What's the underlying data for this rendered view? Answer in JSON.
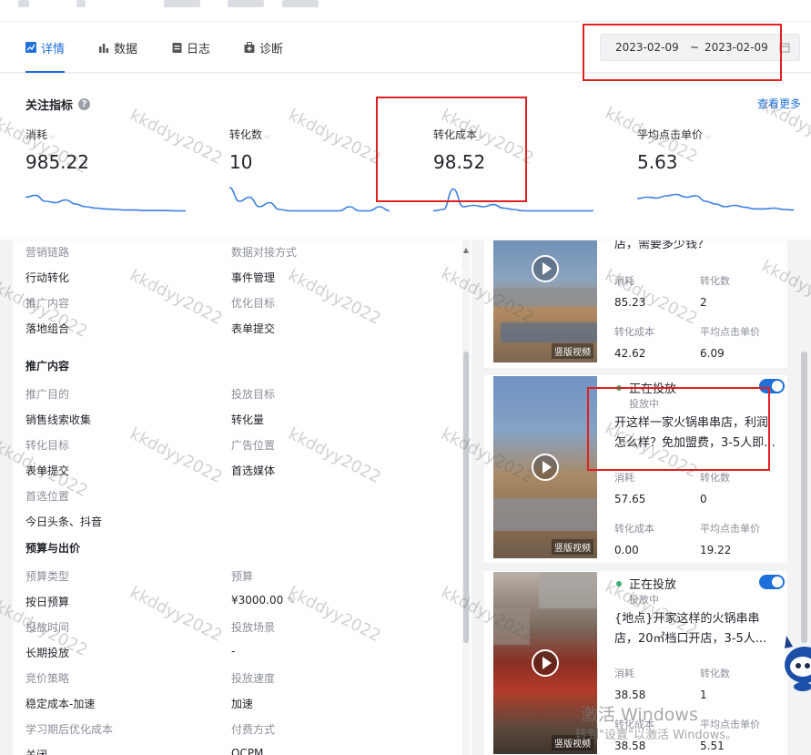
{
  "tabs": [
    {
      "label": "详情",
      "icon": "chart-icon"
    },
    {
      "label": "数据",
      "icon": "bar-chart-icon"
    },
    {
      "label": "日志",
      "icon": "log-icon"
    },
    {
      "label": "诊断",
      "icon": "diagnose-icon"
    }
  ],
  "date_range": {
    "start": "2023-02-09",
    "separator": "~",
    "end": "2023-02-09"
  },
  "metrics": {
    "title": "关注指标",
    "more": "查看更多",
    "items": [
      {
        "label": "消耗",
        "value": "985.22",
        "spark": [
          0.55,
          0.62,
          0.4,
          0.35,
          0.45,
          0.3,
          0.2,
          0.15,
          0.12,
          0.1,
          0.08,
          0.08,
          0.06,
          0.06,
          0.06,
          0.05,
          0.05
        ]
      },
      {
        "label": "转化数",
        "value": "10",
        "spark": [
          0.9,
          0.4,
          0.55,
          0.2,
          0.35,
          0.1,
          0.05,
          0.05,
          0.05,
          0.05,
          0.05,
          0.05,
          0.2,
          0.05,
          0.05,
          0.2,
          0.05
        ]
      },
      {
        "label": "转化成本",
        "value": "98.52",
        "spark": [
          0.05,
          0.1,
          0.85,
          0.2,
          0.25,
          0.2,
          0.28,
          0.15,
          0.1,
          0.05,
          0.05,
          0.05,
          0.05,
          0.05,
          0.05,
          0.05,
          0.05
        ]
      },
      {
        "label": "平均点击单价",
        "value": "5.63",
        "spark": [
          0.5,
          0.55,
          0.52,
          0.6,
          0.65,
          0.55,
          0.6,
          0.4,
          0.3,
          0.2,
          0.25,
          0.18,
          0.12,
          0.12,
          0.15,
          0.1,
          0.08
        ]
      }
    ]
  },
  "left": {
    "rows": [
      {
        "l1": "营销链路",
        "v1": "行动转化",
        "l2": "数据对接方式",
        "v2": "事件管理"
      },
      {
        "l1": "推广内容",
        "v1": "落地组合",
        "l2": "优化目标",
        "v2": "表单提交"
      }
    ],
    "section1": "推广内容",
    "rows2": [
      {
        "l1": "推广目的",
        "v1": "销售线索收集",
        "l2": "投放目标",
        "v2": "转化量"
      },
      {
        "l1": "转化目标",
        "v1": "表单提交",
        "l2": "广告位置",
        "v2": "首选媒体"
      },
      {
        "l1": "首选位置",
        "v1": "今日头条、抖音",
        "l2": "",
        "v2": ""
      }
    ],
    "section2": "预算与出价",
    "rows3": [
      {
        "l1": "预算类型",
        "v1": "按日预算",
        "l2": "预算",
        "v2": "¥3000.00"
      },
      {
        "l1": "投放时间",
        "v1": "长期投放",
        "l2": "投放场景",
        "v2": "-"
      },
      {
        "l1": "竞价策略",
        "v1": "稳定成本-加速",
        "l2": "投放速度",
        "v2": "加速"
      },
      {
        "l1": "学习期后优化成本",
        "v1": "关闭",
        "l2": "付费方式",
        "v2": "OCPM"
      }
    ]
  },
  "cards": [
    {
      "title": "店，需要多少钱？",
      "video_label": "竖版视频",
      "stats": [
        {
          "label": "消耗",
          "value": "85.23"
        },
        {
          "label": "转化数",
          "value": "2"
        },
        {
          "label": "转化成本",
          "value": "42.62"
        },
        {
          "label": "平均点击单价",
          "value": "6.09"
        }
      ]
    },
    {
      "status": "正在投放",
      "sub": "投放中",
      "title_l1": "开这样一家火锅串串店，利润",
      "title_l2": "怎么样？免加盟费，3-5人即...",
      "video_label": "竖版视频",
      "stats": [
        {
          "label": "消耗",
          "value": "57.65"
        },
        {
          "label": "转化数",
          "value": "0"
        },
        {
          "label": "转化成本",
          "value": "0.00"
        },
        {
          "label": "平均点击单价",
          "value": "19.22"
        }
      ]
    },
    {
      "status": "正在投放",
      "sub": "投放中",
      "title_l1": "{地点}开家这样的火锅串串",
      "title_l2": "店，20㎡档口开店，3-5人...",
      "video_label": "竖版视频",
      "stats": [
        {
          "label": "消耗",
          "value": "38.58"
        },
        {
          "label": "转化数",
          "value": "1"
        },
        {
          "label": "转化成本",
          "value": "38.58"
        },
        {
          "label": "平均点击单价",
          "value": "5.51"
        }
      ]
    }
  ],
  "watermark": "kkddyy2022",
  "windows_watermark": {
    "line1": "激活 Windows",
    "line2": "转到\"设置\"以激活 Windows。"
  },
  "colors": {
    "accent": "#1e6fd9",
    "highlight": "#e02020",
    "status_green": "#3cb371",
    "spark_line": "#3b7fe0"
  }
}
